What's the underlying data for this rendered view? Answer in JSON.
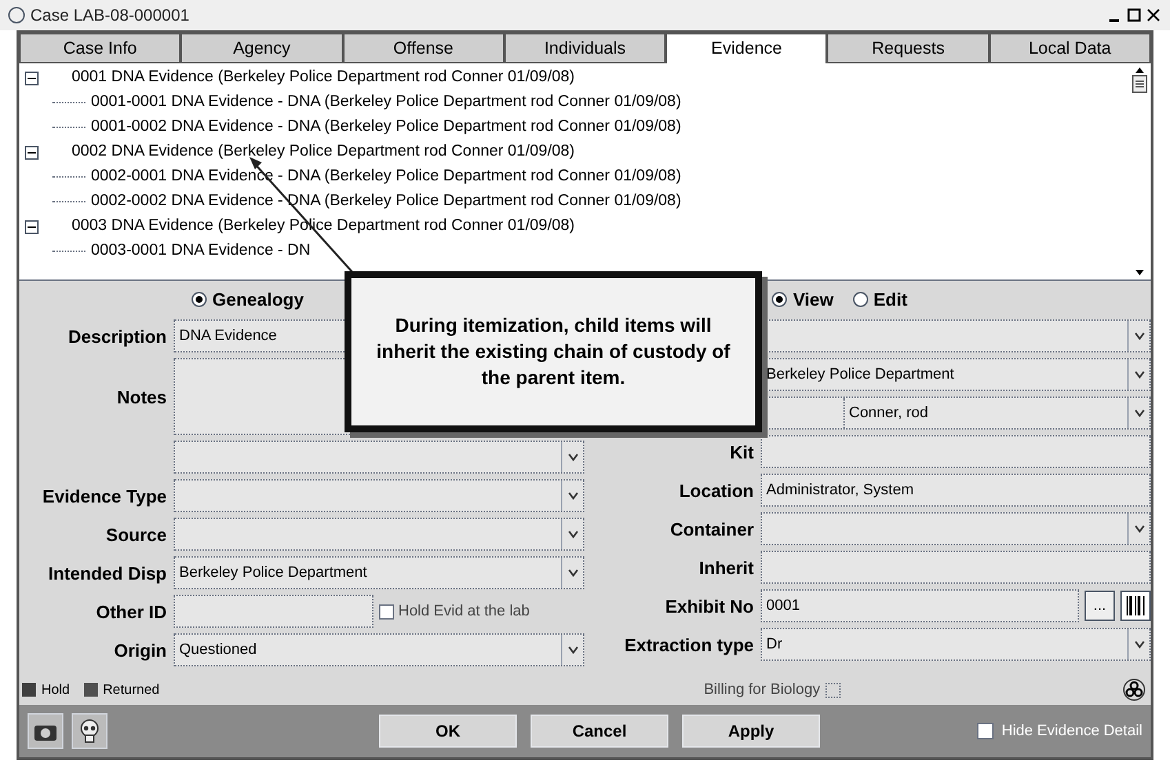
{
  "window": {
    "title": "Case LAB-08-000001"
  },
  "tabs": [
    {
      "label": "Case Info",
      "selected": false
    },
    {
      "label": "Agency",
      "selected": false
    },
    {
      "label": "Offense",
      "selected": false
    },
    {
      "label": "Individuals",
      "selected": false
    },
    {
      "label": "Evidence",
      "selected": true
    },
    {
      "label": "Requests",
      "selected": false
    },
    {
      "label": "Local Data",
      "selected": false
    }
  ],
  "tree": [
    {
      "label": "0001 DNA Evidence (Berkeley Police Department rod Conner 01/09/08)",
      "expanded": true,
      "children": [
        {
          "label": "0001-0001 DNA Evidence - DNA (Berkeley Police Department rod Conner 01/09/08)"
        },
        {
          "label": "0001-0002 DNA Evidence - DNA (Berkeley Police Department rod Conner 01/09/08)"
        }
      ]
    },
    {
      "label": "0002 DNA Evidence (Berkeley Police Department rod Conner 01/09/08)",
      "expanded": true,
      "children": [
        {
          "label": "0002-0001 DNA Evidence - DNA (Berkeley Police Department rod Conner 01/09/08)"
        },
        {
          "label": "0002-0002 DNA Evidence - DNA (Berkeley Police Department rod Conner 01/09/08)"
        }
      ]
    },
    {
      "label": "0003 DNA Evidence (Berkeley Police Department rod Conner 01/09/08)",
      "expanded": true,
      "children": [
        {
          "label": "0003-0001 DNA Evidence - DN"
        }
      ]
    }
  ],
  "genealogy": {
    "label": "Genealogy",
    "selected": true
  },
  "mode_radios": [
    {
      "label": "View",
      "selected": true
    },
    {
      "label": "Edit",
      "selected": false
    }
  ],
  "left_fields": [
    {
      "kind": "text",
      "label": "Description",
      "value": "DNA Evidence"
    },
    {
      "kind": "area",
      "label": "Notes"
    },
    {
      "kind": "dropdown"
    },
    {
      "kind": "dropdown",
      "label": "Evidence Type"
    },
    {
      "kind": "dropdown",
      "label": "Source"
    },
    {
      "kind": "dropdown",
      "label": "Intended Disp",
      "value": "Berkeley Police Department"
    },
    {
      "kind": "check",
      "label": "Other ID",
      "check_label": "Hold Evid at the lab",
      "checked": false
    },
    {
      "kind": "dropdown",
      "label": "Origin",
      "value": "Questioned"
    }
  ],
  "right_fields": [
    {
      "kind": "dropdown"
    },
    {
      "kind": "dropdown",
      "value": "Berkeley Police Department"
    },
    {
      "kind": "split",
      "value": "Conner, rod"
    },
    {
      "kind": "text",
      "label": "Kit"
    },
    {
      "kind": "text",
      "label": "Location",
      "value": "Administrator, System"
    },
    {
      "kind": "dropdown",
      "label": "Container"
    },
    {
      "kind": "text",
      "label": "Inherit"
    },
    {
      "kind": "exhibit",
      "label": "Exhibit No",
      "value": "0001",
      "button": "..."
    },
    {
      "kind": "dropdown",
      "label": "Extraction type",
      "value": "Dr"
    }
  ],
  "legend": [
    {
      "label": "Hold",
      "color": "#404040"
    },
    {
      "label": "Returned",
      "color": "#505050"
    }
  ],
  "billing": {
    "label": "Billing for Biology",
    "checked": false
  },
  "buttons": [
    "OK",
    "Cancel",
    "Apply"
  ],
  "detail_toggle": {
    "label": "Hide Evidence Detail",
    "checked": false
  },
  "callout": "During itemization, child items will inherit the existing chain of custody of the parent item."
}
